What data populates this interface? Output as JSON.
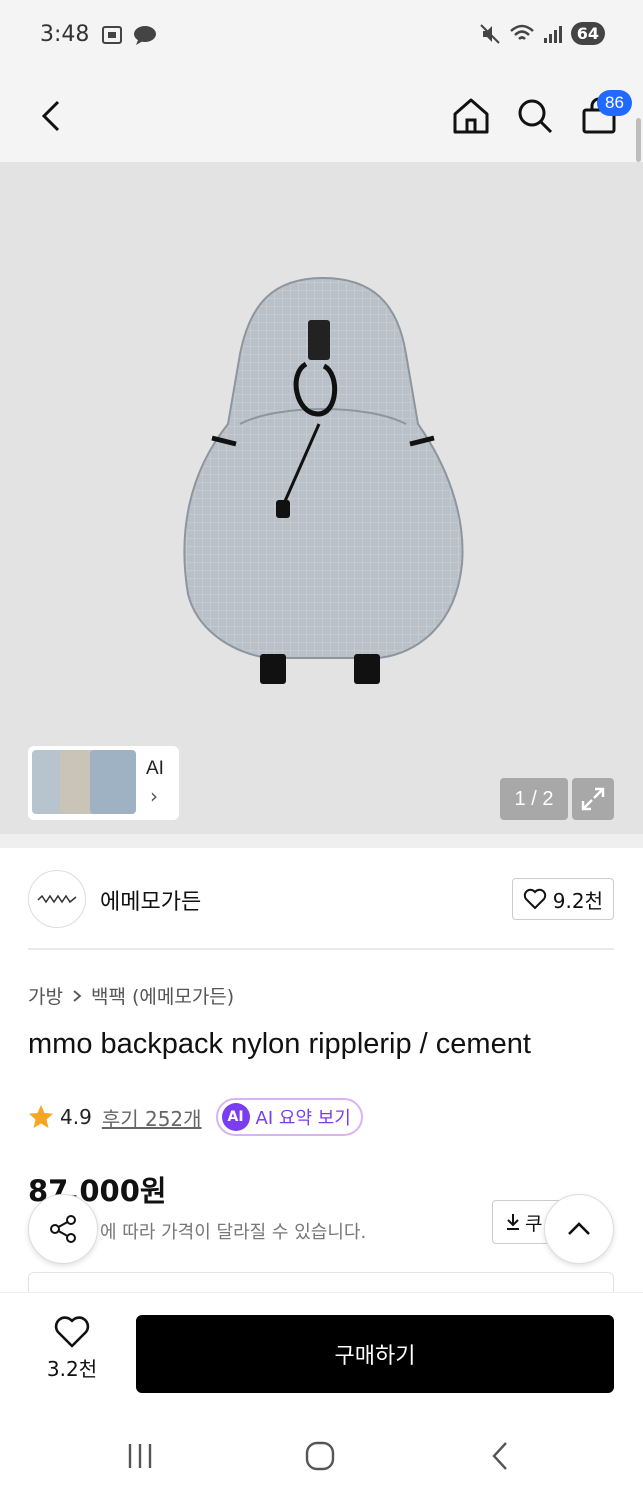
{
  "status_bar": {
    "time": "3:48",
    "battery": "64"
  },
  "header": {
    "cart_count": "86"
  },
  "gallery": {
    "thumb_ai_label": "AI",
    "page_indicator": "1 / 2"
  },
  "brand": {
    "name": "에메모가든",
    "like_count": "9.2천"
  },
  "breadcrumb": {
    "category": "가방",
    "subcategory": "백팩 (에메모가든)"
  },
  "product": {
    "title": "mmo backpack nylon ripplerip / cement",
    "rating": "4.9",
    "review_link": "후기 252개",
    "ai_badge": "AI",
    "ai_summary_label": "AI 요약 보기",
    "price": "87,000원",
    "price_note": "에 따라 가격이 달라질 수 있습니다.",
    "coupon_label": "쿠"
  },
  "bottom_bar": {
    "wish_count": "3.2천",
    "buy_label": "구매하기"
  },
  "colors": {
    "accent_blue": "#1f6bff",
    "ai_purple": "#7a3df0",
    "star": "#f5a623",
    "buy_bg": "#000000"
  }
}
